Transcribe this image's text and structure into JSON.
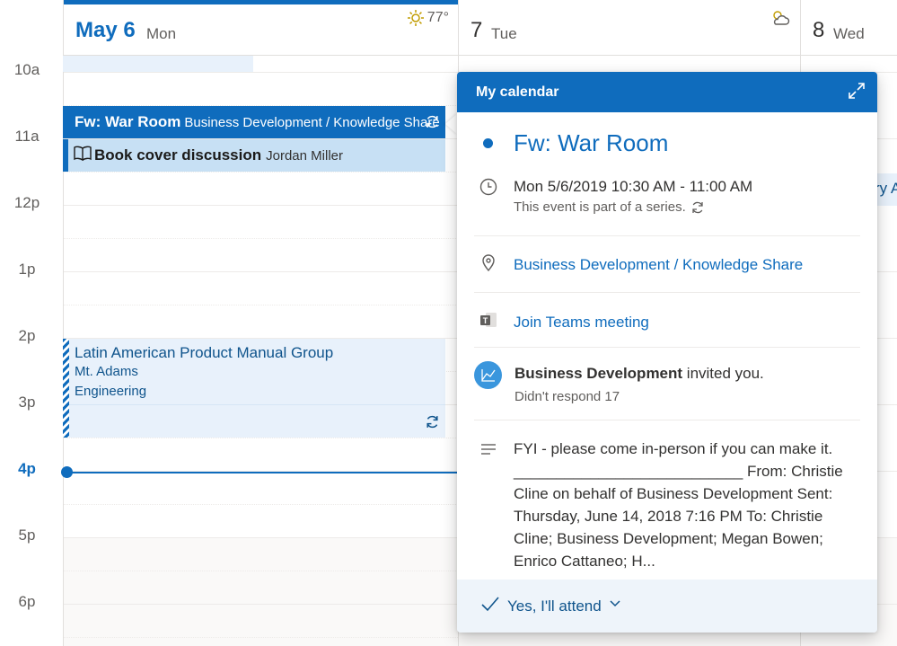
{
  "time_labels": [
    "10a",
    "11a",
    "12p",
    "1p",
    "2p",
    "3p",
    "4p",
    "5p",
    "6p"
  ],
  "days": {
    "mon": {
      "num": "May 6",
      "dow": "Mon",
      "weather": "77°",
      "weather_icon": "sun-icon"
    },
    "tue": {
      "num": "7",
      "dow": "Tue",
      "weather_icon": "partly-cloudy-icon"
    },
    "wed": {
      "num": "8",
      "dow": "Wed"
    }
  },
  "events": {
    "war_room": {
      "title": "Fw: War Room",
      "location": "Business Development / Knowledge Share"
    },
    "book_cover": {
      "title": "Book cover discussion",
      "organizer": "Jordan Miller"
    },
    "latin_american": {
      "title": "Latin American Product Manual Group",
      "line1": "Mt. Adams",
      "line2": "Engineering"
    },
    "wed_partial": {
      "title": "ry A"
    }
  },
  "popup": {
    "header": "My calendar",
    "title": "Fw: War Room",
    "when": "Mon 5/6/2019 10:30 AM - 11:00 AM",
    "series_note": "This event is part of a series.",
    "location": "Business Development / Knowledge Share",
    "teams_link": "Join Teams meeting",
    "organizer_name": "Business Development",
    "invited_text": " invited you.",
    "response_status": "Didn't respond 17",
    "body": "FYI - please come in-person if you can make it. ___________________________ From: Christie Cline on behalf of Business Development Sent: Thursday, June 14, 2018 7:16 PM To: Christie Cline; Business Development; Megan Bowen; Enrico Cattaneo; H...",
    "rsvp_label": "Yes, I'll attend"
  },
  "colors": {
    "accent": "#0f6cbd",
    "event_fill": "#e8f1fb",
    "event_fill_selected": "#c7e0f4"
  }
}
